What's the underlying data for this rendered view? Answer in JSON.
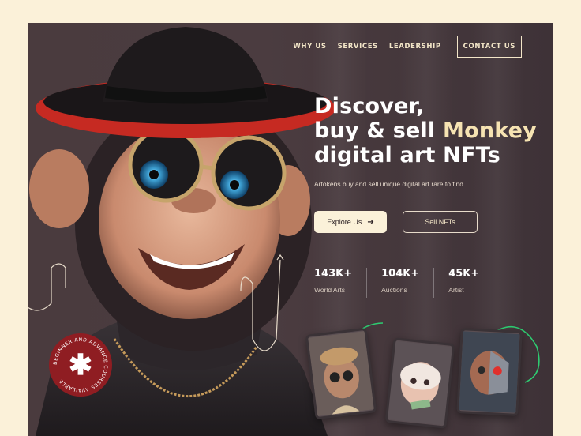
{
  "nav": {
    "links": [
      "WHY US",
      "SERVICES",
      "LEADERSHIP"
    ],
    "contact": "CONTACT US"
  },
  "hero": {
    "line1": "Discover,",
    "line2a": "buy & sell ",
    "line2b": "Monkey",
    "line3": "digital art NFTs",
    "subtext": "Artokens buy and sell unique digital art rare to find.",
    "primary_button": "Explore Us",
    "secondary_button": "Sell NFTs"
  },
  "stats": [
    {
      "value": "143K+",
      "label": "World Arts"
    },
    {
      "value": "104K+",
      "label": "Auctions"
    },
    {
      "value": "45K+",
      "label": "Artist"
    }
  ],
  "badge": {
    "text": "BEGINNER AND ADVANCE COURSES AVAILABLE"
  },
  "colors": {
    "background": "#fbf1d9",
    "panel": "#4a3b3e",
    "accent": "#f6e3b2",
    "badge": "#8f1d22",
    "neon": "#2ecc71"
  }
}
